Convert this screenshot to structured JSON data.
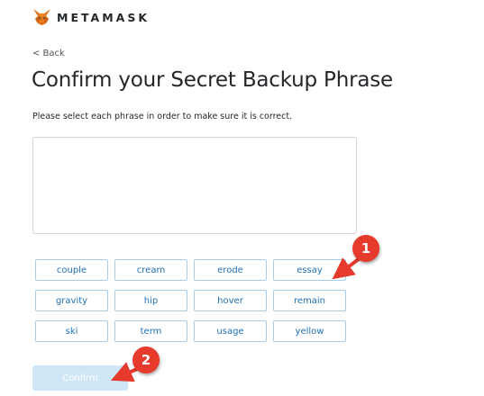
{
  "header": {
    "brand": "METAMASK",
    "logo_icon": "metamask-fox-icon"
  },
  "back_label": "< Back",
  "title": "Confirm your Secret Backup Phrase",
  "subtitle": "Please select each phrase in order to make sure it is correct.",
  "words": [
    "couple",
    "cream",
    "erode",
    "essay",
    "gravity",
    "hip",
    "hover",
    "remain",
    "ski",
    "term",
    "usage",
    "yellow"
  ],
  "confirm_label": "Confirm",
  "callouts": [
    "1",
    "2"
  ],
  "colors": {
    "accent": "#1f71b5",
    "button_disabled": "#cfe6f7",
    "callout": "#e53a2c"
  }
}
